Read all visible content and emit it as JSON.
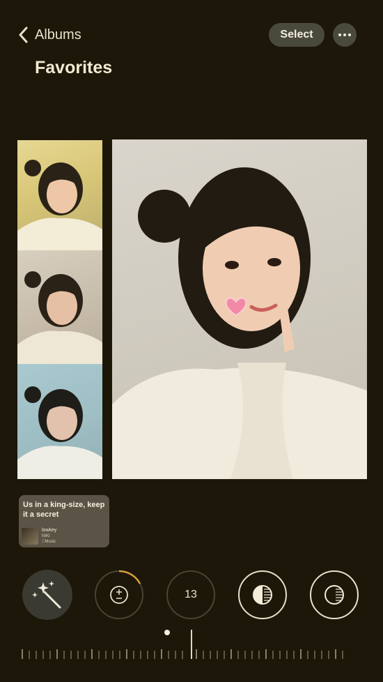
{
  "nav": {
    "back_label": "Albums",
    "select_label": "Select",
    "title": "Favorites"
  },
  "photos": {
    "main_sticker": "heart"
  },
  "music_card": {
    "lyric": "Us in a king-size, keep it a secret",
    "song": "lowkey",
    "artist": "NIKI",
    "service": "Music"
  },
  "edit_tools": [
    {
      "name": "auto",
      "icon": "magic-wand-icon"
    },
    {
      "name": "exposure",
      "icon": "plus-minus-icon",
      "ring_progress": 0.2
    },
    {
      "name": "brilliance",
      "icon": "none",
      "value": "13",
      "ring_progress": 0.0
    },
    {
      "name": "highlights",
      "icon": "half-circle-icon",
      "selected": true
    },
    {
      "name": "shadows",
      "icon": "half-circle-icon",
      "selected": false
    }
  ],
  "colors": {
    "background": "#1c1708",
    "button_bg": "#4a4a3c",
    "accent_ring": "#d9a13a",
    "text": "#f2ead0"
  }
}
